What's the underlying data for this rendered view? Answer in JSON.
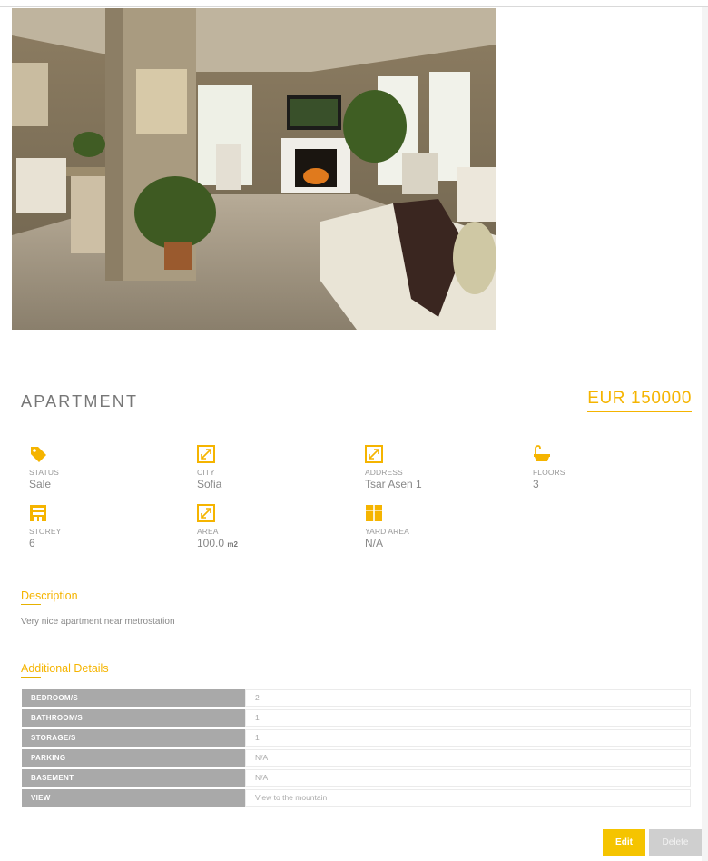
{
  "listing": {
    "title": "APARTMENT",
    "price": "EUR 150000"
  },
  "features": [
    {
      "icon": "tag-icon",
      "label": "STATUS",
      "value": "Sale"
    },
    {
      "icon": "expand-arrows-icon",
      "label": "CITY",
      "value": "Sofia"
    },
    {
      "icon": "expand-arrows-icon",
      "label": "ADDRESS",
      "value": "Tsar Asen 1"
    },
    {
      "icon": "bathtub-icon",
      "label": "FLOORS",
      "value": "3"
    },
    {
      "icon": "building-icon",
      "label": "STOREY",
      "value": "6"
    },
    {
      "icon": "expand-arrows-icon",
      "label": "AREA",
      "value": "100.0",
      "unit": "m2"
    },
    {
      "icon": "window-grid-icon",
      "label": "YARD AREA",
      "value": "N/A"
    }
  ],
  "description": {
    "title": "Description",
    "text": "Very nice apartment near metrostation"
  },
  "additional": {
    "title": "Additional Details",
    "rows": [
      {
        "key": "BEDROOM/S",
        "value": "2"
      },
      {
        "key": "BATHROOM/S",
        "value": "1"
      },
      {
        "key": "STORAGE/S",
        "value": "1"
      },
      {
        "key": "PARKING",
        "value": "N/A"
      },
      {
        "key": "BASEMENT",
        "value": "N/A"
      },
      {
        "key": "VIEW",
        "value": "View to the mountain"
      }
    ]
  },
  "actions": {
    "edit_label": "Edit",
    "delete_label": "Delete"
  },
  "colors": {
    "accent": "#f5b400",
    "table_key_bg": "#a9a9a9"
  }
}
